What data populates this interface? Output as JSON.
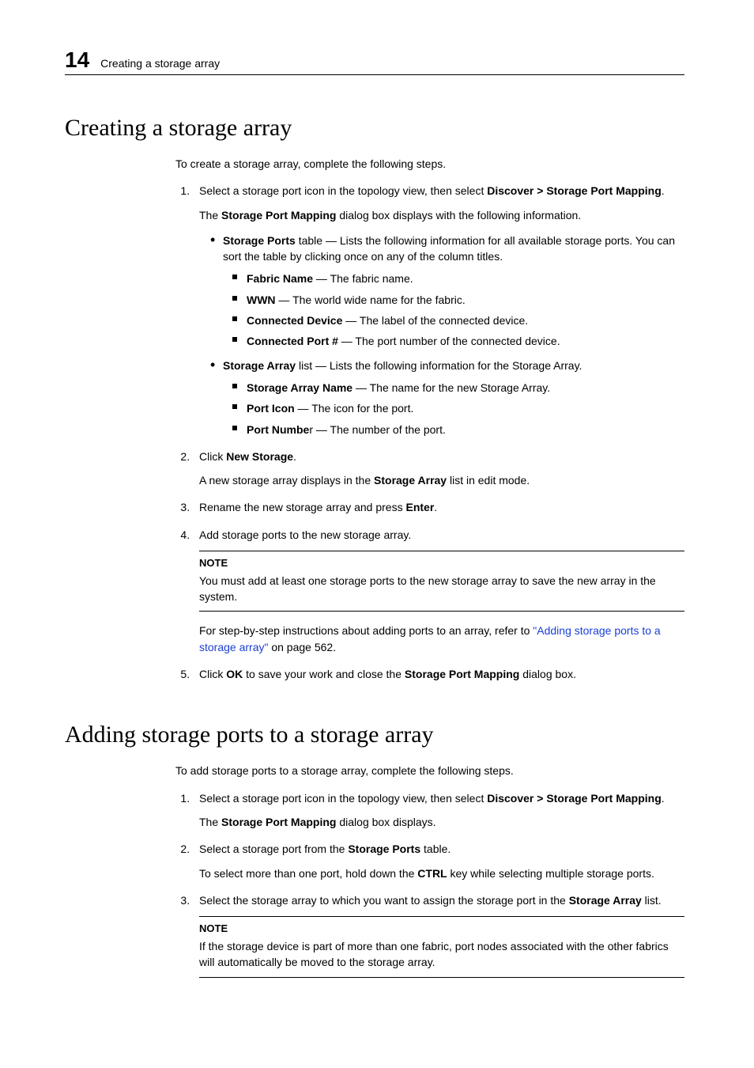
{
  "header": {
    "chapter": "14",
    "section": "Creating a storage array"
  },
  "s1": {
    "title": "Creating a storage array",
    "intro": "To create a storage array, complete the following steps.",
    "step1_pre": "Select a storage port icon in the topology view, then select ",
    "step1_bold": "Discover > Storage Port Mapping",
    "step1_post": ".",
    "step1_sub_pre": "The ",
    "step1_sub_bold": "Storage Port Mapping",
    "step1_sub_post": " dialog box displays with the following information.",
    "sp_bold": "Storage Ports",
    "sp_rest": " table — Lists the following information for all available storage ports. You can sort the table by clicking once on any of the column titles.",
    "sp_items": {
      "fabric_b": "Fabric Name",
      "fabric_r": " — The fabric name.",
      "wwn_b": "WWN",
      "wwn_r": " — The world wide name for the fabric.",
      "cd_b": "Connected Device",
      "cd_r": " — The label of the connected device.",
      "cp_b": "Connected Port #",
      "cp_r": " — The port number of the connected device."
    },
    "sa_bold": "Storage Array",
    "sa_rest": " list — Lists the following information for the Storage Array.",
    "sa_items": {
      "name_b": "Storage Array Name",
      "name_r": " — The name for the new Storage Array.",
      "icon_b": "Port Icon",
      "icon_r": " — The icon for the port.",
      "num_b": "Port Numbe",
      "num_mid": "r",
      "num_r": " — The number of the port."
    },
    "step2_pre": "Click ",
    "step2_bold": "New Storage",
    "step2_post": ".",
    "step2_sub_pre": "A new storage array displays in the ",
    "step2_sub_bold": "Storage Array",
    "step2_sub_post": " list in edit mode.",
    "step3_pre": "Rename the new storage array and press ",
    "step3_bold": "Enter",
    "step3_post": ".",
    "step4": "Add storage ports to the new storage array.",
    "note_label": "NOTE",
    "note_text": "You must add at least one storage ports to the new storage array to save the new array in the system.",
    "ref_pre": "For step-by-step instructions about adding ports to an array, refer to ",
    "ref_link": "\"Adding storage ports to a storage array\"",
    "ref_post": " on page 562.",
    "step5_pre": "Click ",
    "step5_bold": "OK",
    "step5_mid": " to save your work and close the ",
    "step5_bold2": "Storage Port Mapping",
    "step5_post": " dialog box."
  },
  "s2": {
    "title": "Adding storage ports to a storage array",
    "intro": "To add storage ports to a storage array, complete the following steps.",
    "step1_pre": "Select a storage port icon in the topology view, then select ",
    "step1_bold": "Discover > Storage Port Mapping",
    "step1_post": ".",
    "step1_sub_pre": "The ",
    "step1_sub_bold": "Storage Port Mapping",
    "step1_sub_post": " dialog box displays.",
    "step2_pre": "Select a storage port from the ",
    "step2_bold": "Storage Ports",
    "step2_post": " table.",
    "step2_sub_pre": "To select more than one port, hold down the ",
    "step2_sub_bold": "CTRL",
    "step2_sub_post": " key while selecting multiple storage ports.",
    "step3_pre": "Select the storage array to which you want to assign the storage port in the ",
    "step3_bold": "Storage Array",
    "step3_post": " list.",
    "note_label": "NOTE",
    "note_text": "If the storage device is part of more than one fabric, port nodes associated with the other fabrics will automatically be moved to the storage array."
  }
}
